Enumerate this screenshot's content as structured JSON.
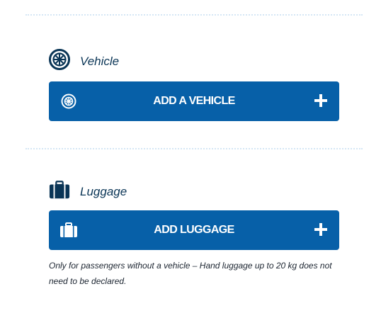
{
  "vehicle": {
    "label": "Vehicle",
    "icon": "wheel-icon",
    "button_label": "ADD A VEHICLE",
    "button_icon": "wheel-icon",
    "action_icon": "plus-icon"
  },
  "luggage": {
    "label": "Luggage",
    "icon": "suitcase-icon",
    "button_label": "ADD LUGGAGE",
    "button_icon": "suitcase-icon",
    "action_icon": "plus-icon",
    "note": "Only for passengers without a vehicle – Hand luggage up to 20 kg does not need to be declared."
  },
  "colors": {
    "button_bg": "#0760a8",
    "heading_text": "#0a3556",
    "divider": "#d4e6f5"
  }
}
